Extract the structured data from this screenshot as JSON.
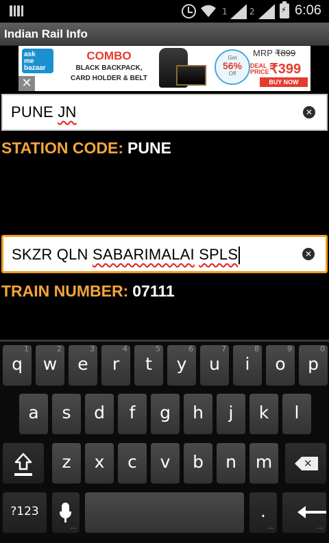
{
  "status_bar": {
    "sim1_label": "1",
    "sim2_label": "2",
    "time": "6:06",
    "icons": [
      "notification-bars-icon",
      "alarm-icon",
      "wifi-icon",
      "signal-icon",
      "battery-charging-icon"
    ]
  },
  "app": {
    "title": "Indian Rail Info"
  },
  "ad": {
    "logo_lines": [
      "ask",
      "me",
      "bazaar",
      ".com"
    ],
    "close": "✕",
    "headline": "COMBO",
    "line1": "BLACK BACKPACK,",
    "line2": "CARD HOLDER & BELT",
    "discount_top": "Get",
    "discount_pct": "56%",
    "discount_bot": "Off",
    "mrp_label": "MRP",
    "mrp_value": "₹899",
    "deal_label": "DEAL PRICE",
    "deal_value": "₹399",
    "buy_label": "BUY NOW"
  },
  "station": {
    "input_value_word1": "PUNE",
    "input_value_word2": "JN",
    "code_label": "STATION CODE:",
    "code_value": "PUNE"
  },
  "train": {
    "input_words": [
      "SKZR",
      "QLN",
      "SABARIMALAI",
      "SPLS"
    ],
    "number_label": "TRAIN NUMBER:",
    "number_value": "07111"
  },
  "keyboard": {
    "row1": [
      {
        "key": "q",
        "hint": "1"
      },
      {
        "key": "w",
        "hint": "2"
      },
      {
        "key": "e",
        "hint": "3"
      },
      {
        "key": "r",
        "hint": "4"
      },
      {
        "key": "t",
        "hint": "5"
      },
      {
        "key": "y",
        "hint": "6"
      },
      {
        "key": "u",
        "hint": "7"
      },
      {
        "key": "i",
        "hint": "8"
      },
      {
        "key": "o",
        "hint": "9"
      },
      {
        "key": "p",
        "hint": "0"
      }
    ],
    "row2": [
      "a",
      "s",
      "d",
      "f",
      "g",
      "h",
      "j",
      "k",
      "l"
    ],
    "row3": [
      "z",
      "x",
      "c",
      "v",
      "b",
      "n",
      "m"
    ],
    "symbols_label": "?123",
    "period_label": ".",
    "dots": "..."
  },
  "colors": {
    "label_orange": "#f4a53b",
    "focus_border": "#f0a01c",
    "spell_underline": "#e02020"
  }
}
